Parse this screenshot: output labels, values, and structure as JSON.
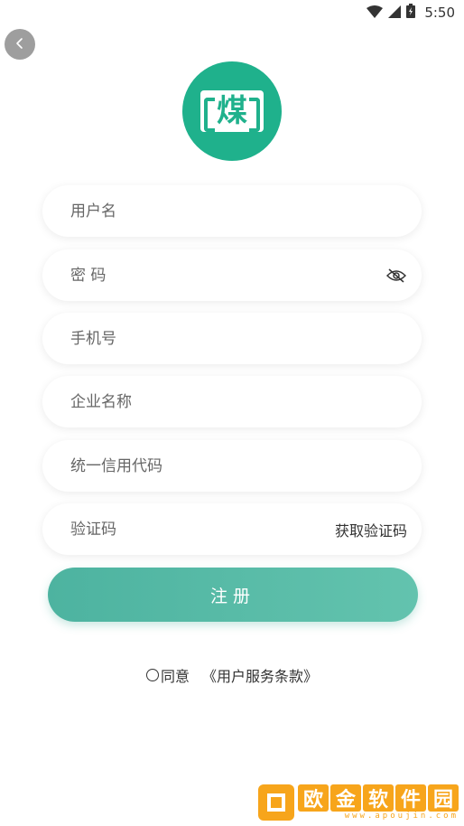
{
  "status_bar": {
    "time": "5:50"
  },
  "logo": {
    "char": "煤"
  },
  "form": {
    "username_placeholder": "用户名",
    "password_placeholder": "密 码",
    "phone_placeholder": "手机号",
    "company_placeholder": "企业名称",
    "credit_code_placeholder": "统一信用代码",
    "verify_code_placeholder": "验证码",
    "get_code_label": "获取验证码"
  },
  "register_label": "注册",
  "agreement": {
    "agree_text": "同意",
    "terms_link": "《用户服务条款》"
  },
  "watermark": {
    "chars": [
      "欧",
      "金",
      "软",
      "件",
      "园"
    ],
    "url": "www.apoujin.com"
  },
  "colors": {
    "accent": "#1fb18c",
    "button": "#4db3a0",
    "watermark": "#f7a51b"
  }
}
